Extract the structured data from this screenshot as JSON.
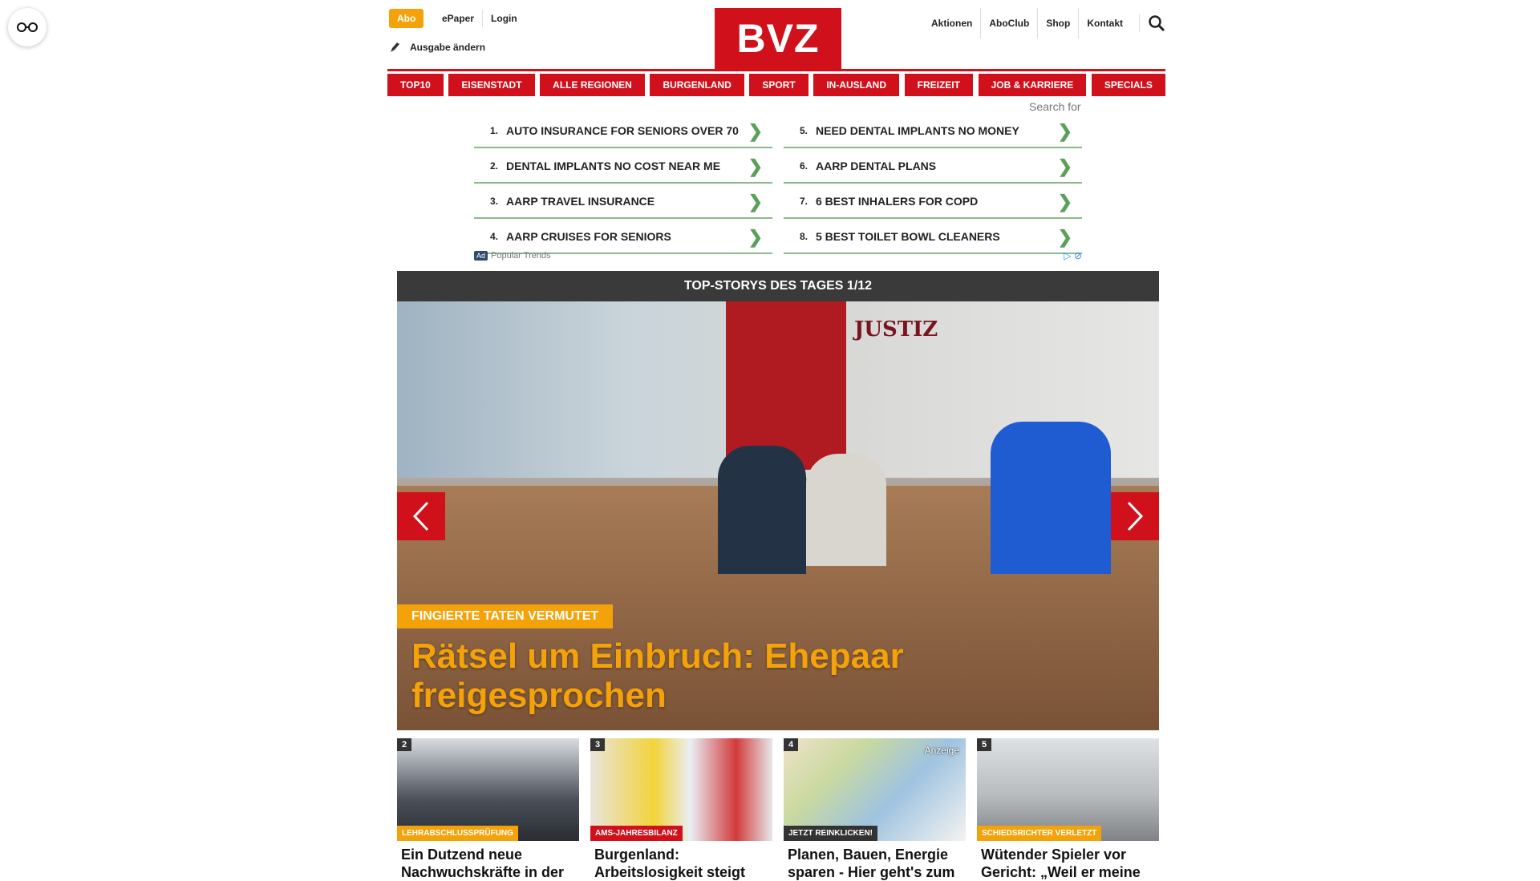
{
  "header": {
    "abo": "Abo",
    "epaper": "ePaper",
    "login": "Login",
    "ausgabe": "Ausgabe ändern",
    "logo": "BVZ",
    "right_links": [
      "Aktionen",
      "AboClub",
      "Shop",
      "Kontakt"
    ]
  },
  "nav": [
    "TOP10",
    "EISENSTADT",
    "ALLE REGIONEN",
    "BURGENLAND",
    "SPORT",
    "IN-AUSLAND",
    "FREIZEIT",
    "JOB & KARRIERE",
    "SPECIALS"
  ],
  "ads": {
    "search_for": "Search for",
    "items": [
      {
        "num": "1.",
        "text": "AUTO INSURANCE FOR SENIORS OVER 70"
      },
      {
        "num": "5.",
        "text": "NEED DENTAL IMPLANTS NO MONEY"
      },
      {
        "num": "2.",
        "text": "DENTAL IMPLANTS NO COST NEAR ME"
      },
      {
        "num": "6.",
        "text": "AARP DENTAL PLANS"
      },
      {
        "num": "3.",
        "text": "AARP TRAVEL INSURANCE"
      },
      {
        "num": "7.",
        "text": "6 BEST INHALERS FOR COPD"
      },
      {
        "num": "4.",
        "text": "AARP CRUISES FOR SENIORS"
      },
      {
        "num": "8.",
        "text": "5 BEST TOILET BOWL CLEANERS"
      }
    ],
    "badge": "Ad",
    "footer": "Popular Trends"
  },
  "hero": {
    "section_title": "TOP-STORYS DES TAGES 1/12",
    "image_sign": "JUSTIZ",
    "kicker": "FINGIERTE TATEN VERMUTET",
    "headline": "Rätsel um Einbruch: Ehepaar freigesprochen"
  },
  "cards": [
    {
      "no": "2",
      "tag": "LEHRABSCHLUSSPRÜFUNG",
      "tag_color": "#f4a20a",
      "title": "Ein Dutzend neue Nachwuchskräfte in der",
      "ad_label": ""
    },
    {
      "no": "3",
      "tag": "AMS-JAHRESBILANZ",
      "tag_color": "#d0111b",
      "title": "Burgenland: Arbeitslosigkeit steigt",
      "ad_label": ""
    },
    {
      "no": "4",
      "tag": "JETZT REINKLICKEN!",
      "tag_color": "#333333",
      "title": "Planen, Bauen, Energie sparen - Hier geht's zum",
      "ad_label": "Anzeige"
    },
    {
      "no": "5",
      "tag": "SCHIEDSRICHTER VERLETZT",
      "tag_color": "#f4a20a",
      "title": "Wütender Spieler vor Gericht: „Weil er meine",
      "ad_label": ""
    }
  ],
  "colors": {
    "brand": "#d0111b",
    "accent": "#f4a20a"
  }
}
